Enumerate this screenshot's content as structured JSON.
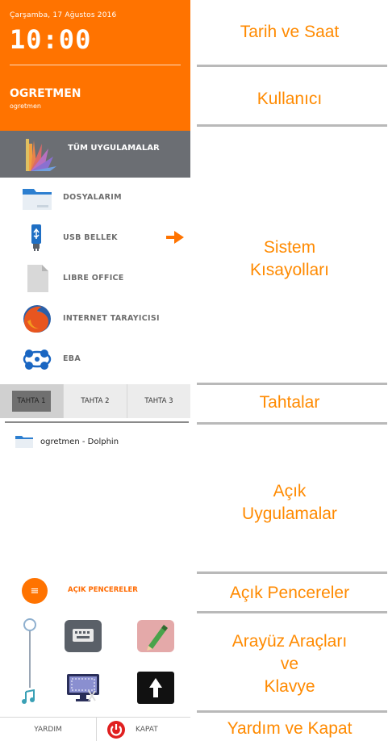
{
  "header": {
    "date": "Çarşamba, 17 Ağustos 2016",
    "time": "10:00",
    "user_name": "OGRETMEN",
    "user_login": "ogretmen"
  },
  "all_apps": {
    "label": "TÜM UYGULAMALAR"
  },
  "shortcuts": [
    {
      "label": "DOSYALARIM",
      "icon": "folder-icon"
    },
    {
      "label": "USB BELLEK",
      "icon": "usb-icon"
    },
    {
      "label": "LIBRE OFFICE",
      "icon": "document-icon"
    },
    {
      "label": "INTERNET TARAYICISI",
      "icon": "firefox-icon"
    },
    {
      "label": "EBA",
      "icon": "eba-icon"
    }
  ],
  "tabs": [
    {
      "label": "TAHTA 1",
      "active": true
    },
    {
      "label": "TAHTA 2",
      "active": false
    },
    {
      "label": "TAHTA 3",
      "active": false
    }
  ],
  "open_apps": [
    {
      "label": "ogretmen - Dolphin",
      "icon": "folder-icon"
    }
  ],
  "open_windows": {
    "label": "AÇIK PENCERELER",
    "icon": "menu-icon"
  },
  "tools": {
    "volume_level": 1.0,
    "icons": [
      "keyboard-icon",
      "pencil-icon",
      "screen-icon",
      "upload-arrow-icon",
      "music-icon"
    ]
  },
  "footer": {
    "help": "YARDIM",
    "shutdown": "KAPAT"
  },
  "annotations": {
    "date_time": "Tarih ve Saat",
    "user": "Kullanıcı",
    "shortcuts_line1": "Sistem",
    "shortcuts_line2": "Kısayolları",
    "boards": "Tahtalar",
    "open_apps_line1": "Açık",
    "open_apps_line2": "Uygulamalar",
    "open_windows": "Açık Pencereler",
    "tools_line1": "Arayüz Araçları",
    "tools_line2": "ve",
    "tools_line3": "Klavye",
    "help_shutdown": "Yardım ve Kapat"
  },
  "colors": {
    "accent": "#ff7300",
    "annotation": "#ff8a00",
    "apps_bar": "#6b6e73"
  }
}
